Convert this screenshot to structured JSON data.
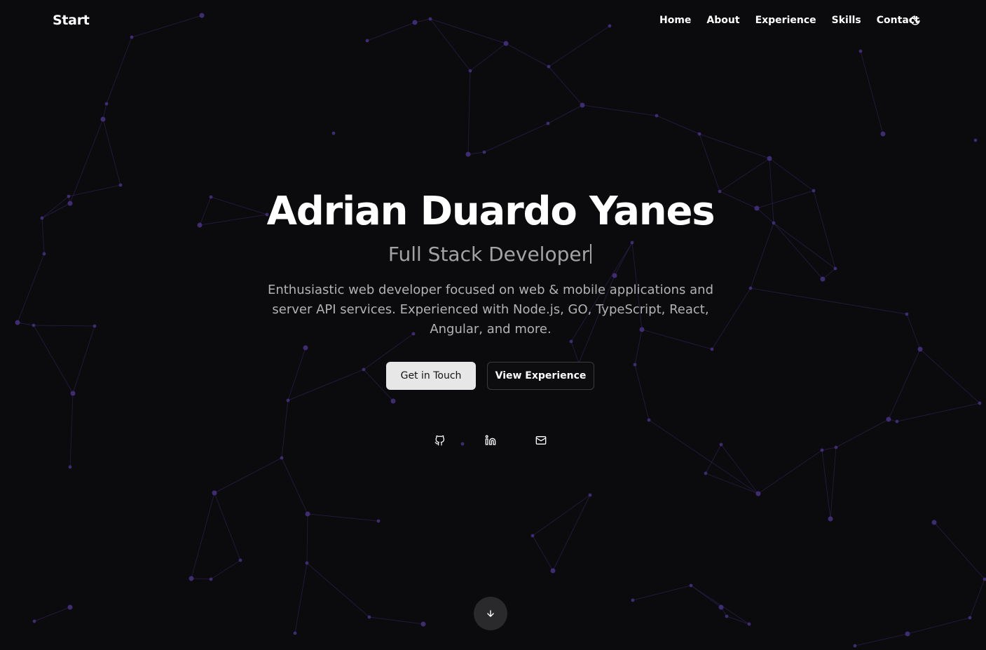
{
  "header": {
    "brand": "Start",
    "nav": [
      "Home",
      "About",
      "Experience",
      "Skills",
      "Contact"
    ],
    "theme_icon": "moon-icon"
  },
  "hero": {
    "name": "Adrian Duardo Yanes",
    "role": "Full Stack Developer",
    "description": "Enthusiastic web developer focused on web & mobile applications and server API services. Experienced with Node.js, GO, TypeScript, React, Angular, and more.",
    "primary_button": "Get in Touch",
    "secondary_button": "View Experience"
  },
  "social": {
    "github_icon": "github-icon",
    "linkedin_icon": "linkedin-icon",
    "email_icon": "mail-icon"
  },
  "scroll_icon": "arrow-down-icon",
  "colors": {
    "background": "#0b0a0c",
    "network": "#43307d",
    "text": "#ffffff",
    "muted": "#a3a3a3",
    "primary_button_bg": "#e7e7e7"
  }
}
